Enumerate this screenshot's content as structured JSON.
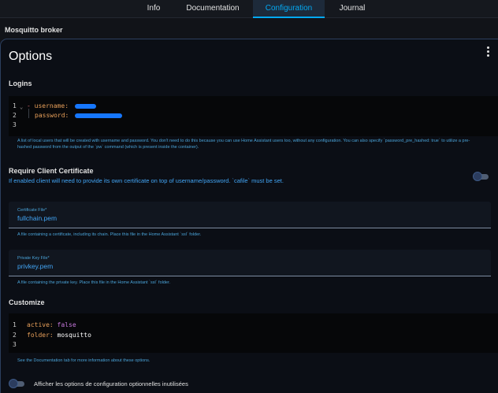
{
  "tabs": [
    {
      "label": "Info",
      "active": false
    },
    {
      "label": "Documentation",
      "active": false
    },
    {
      "label": "Configuration",
      "active": true
    },
    {
      "label": "Journal",
      "active": false
    }
  ],
  "page_title": "Mosquitto broker",
  "card": {
    "title": "Options",
    "menu_icon": "dots-vertical-icon"
  },
  "logins": {
    "title": "Logins",
    "lines": [
      {
        "num": "1",
        "dash": "-",
        "key": "username:"
      },
      {
        "num": "2",
        "key": "password:"
      },
      {
        "num": "3"
      }
    ],
    "helper": "A list of local users that will be created with username and password. You don't need to do this because you can use Home Assistant users too, without any configuration. You can also specify `password_pre_hashed: true` to utilize a pre-hashed password from the output of the `pw` command (which is present inside the container)."
  },
  "client_cert": {
    "title": "Require Client Certificate",
    "description": "If enabled client will need to provide its own certificate on top of username/password. `cafile` must be set.",
    "enabled": false
  },
  "certfile": {
    "label": "Certificate File*",
    "value": "fullchain.pem",
    "helper": "A file containing a certificate, including its chain. Place this file in the Home Assistant `ssl` folder."
  },
  "keyfile": {
    "label": "Private Key File*",
    "value": "privkey.pem",
    "helper": "A file containing the private key. Place this file in the Home Assistant `ssl` folder."
  },
  "customize": {
    "title": "Customize",
    "lines": [
      {
        "num": "1",
        "key": "active:",
        "value": "false"
      },
      {
        "num": "2",
        "key": "folder:",
        "value": "mosquitto"
      },
      {
        "num": "3"
      }
    ],
    "helper": "See the Documentation tab for more information about these options."
  },
  "show_optional": {
    "label": "Afficher les options de configuration optionnelles inutilisées",
    "enabled": false
  },
  "colors": {
    "accent": "#03a9f4",
    "background": "#111318",
    "card": "#0b0e15",
    "link_text": "#42a5f5"
  }
}
